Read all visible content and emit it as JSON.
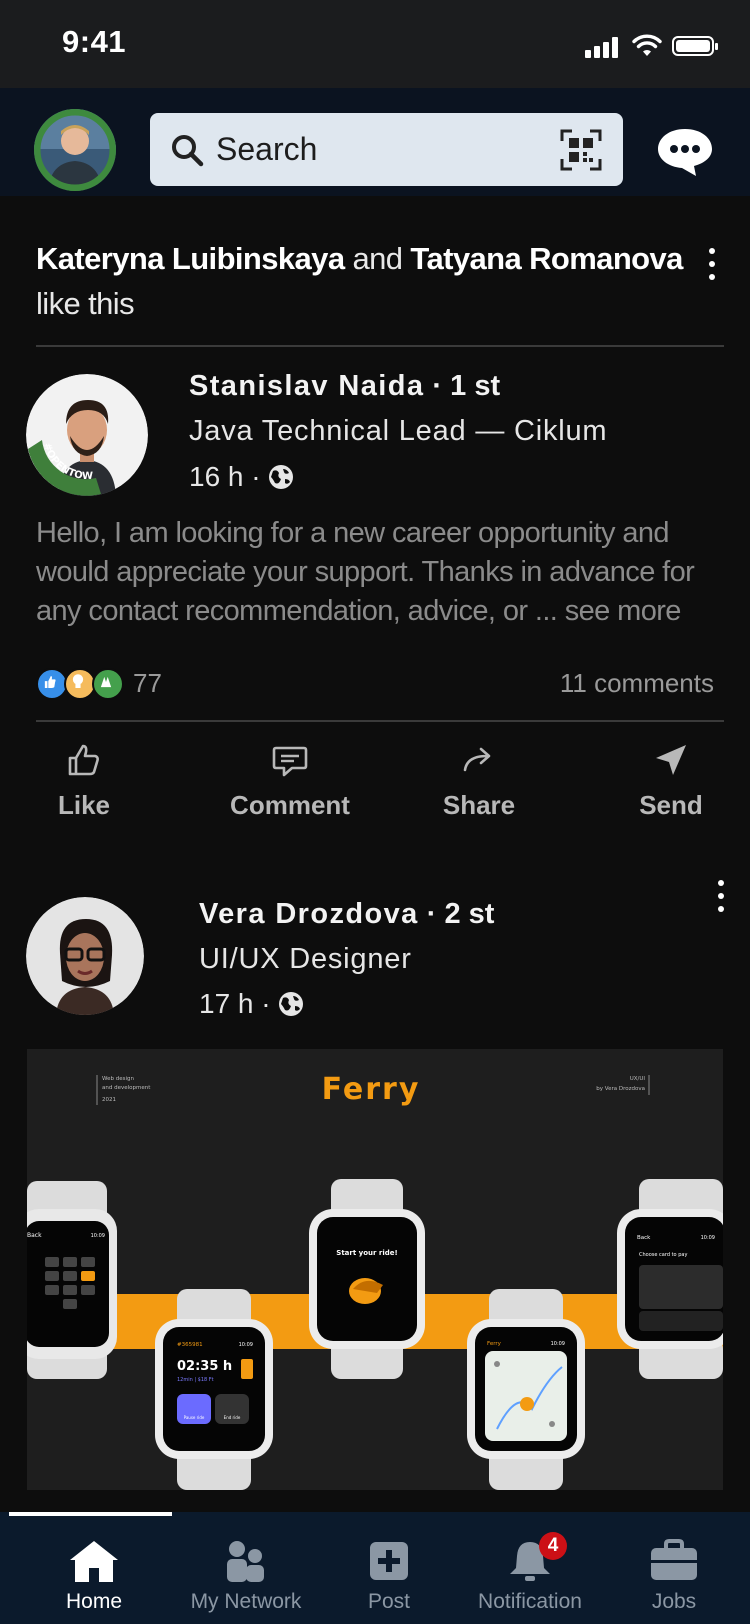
{
  "status_bar": {
    "time": "9:41"
  },
  "top_nav": {
    "search_placeholder": "Search"
  },
  "feed": {
    "post1": {
      "social_actor_1": "Kateryna Luibinskaya",
      "social_and": " and ",
      "social_actor_2": "Tatyana Romanova",
      "social_suffix": " like this",
      "author_name": "Stanislav Naida",
      "degree": "1 st",
      "headline": "Java Technical Lead — Ciklum",
      "time_ago": "16 h",
      "body": "Hello, I am looking for a new career opportunity and would appreciate your support. Thanks in advance for any contact recommendation, advice, or",
      "see_more": "... see more",
      "reaction_count": "77",
      "comments": "11 comments",
      "avatar_ring_text": "#OPENTOWORK"
    },
    "post2": {
      "author_name": "Vera Drozdova",
      "degree": "2 st",
      "headline": "UI/UX Designer",
      "time_ago": "17 h",
      "image": {
        "title": "Ferry",
        "left_caption_1": "Web design",
        "left_caption_2": "and development",
        "left_caption_3": "2021",
        "right_caption_1": "UX/UI",
        "right_caption_2": "by Vera Drozdova",
        "watch_center_text": "Start your ride!",
        "watch_left_header": "Back",
        "watch_right_header": "Back",
        "watch_right_title": "Choose card to pay",
        "watch_timer_id": "#365981",
        "watch_timer": "02:35 h",
        "watch_timer_sub": "12min | $18 Ft",
        "watch_btn1": "Pause ride",
        "watch_btn2": "End ride",
        "watch_map_header": "Ferry",
        "clock": "10:09"
      }
    }
  },
  "actions": {
    "like": "Like",
    "comment": "Comment",
    "share": "Share",
    "send": "Send"
  },
  "tabs": [
    {
      "label": "Home",
      "icon": "home-icon",
      "active": true
    },
    {
      "label": "My Network",
      "icon": "network-icon",
      "active": false
    },
    {
      "label": "Post",
      "icon": "post-icon",
      "active": false
    },
    {
      "label": "Notification",
      "icon": "bell-icon",
      "active": false,
      "badge": "4"
    },
    {
      "label": "Jobs",
      "icon": "briefcase-icon",
      "active": false
    }
  ],
  "colors": {
    "accent_orange": "#f39b12",
    "badge_red": "#cc1016",
    "tabbar": "#0b1a2c",
    "search_bg": "#dfe7ef"
  }
}
